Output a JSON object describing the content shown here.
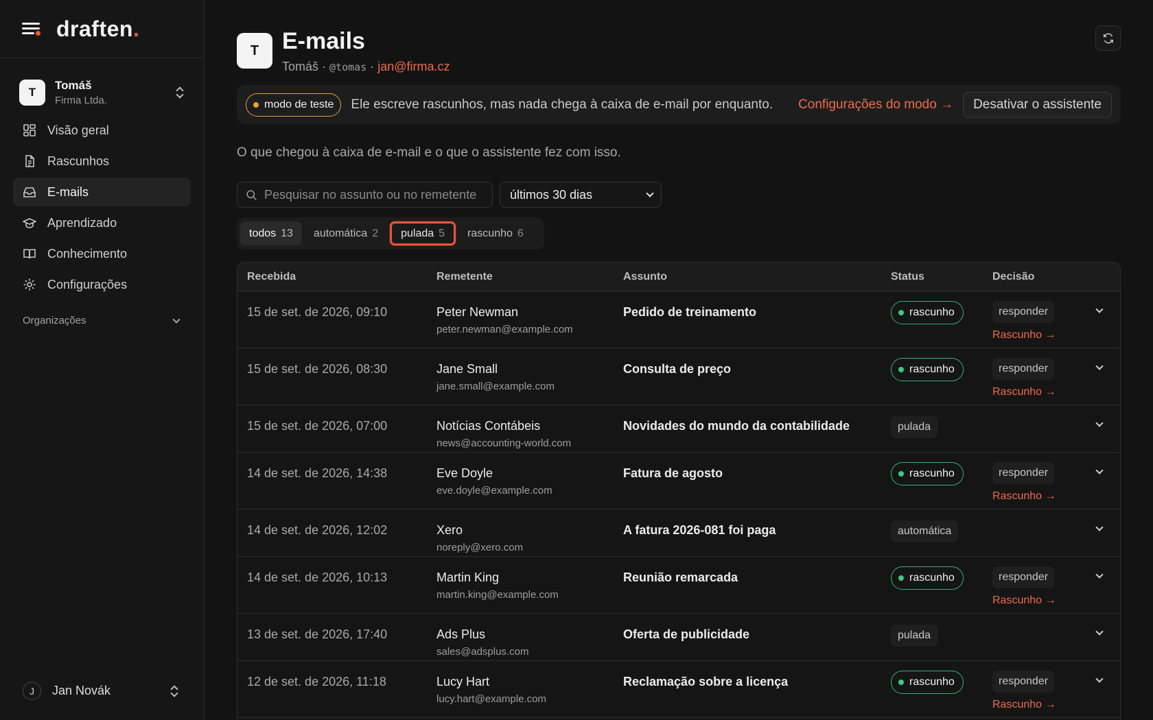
{
  "brand": {
    "name": "draften",
    "accent_char": "."
  },
  "workspace": {
    "initial": "T",
    "name": "Tomáš",
    "org": "Firma Ltda."
  },
  "nav": [
    {
      "label": "Visão geral",
      "icon": "grid-icon",
      "active": false
    },
    {
      "label": "Rascunhos",
      "icon": "document-icon",
      "active": false
    },
    {
      "label": "E-mails",
      "icon": "inbox-icon",
      "active": true
    },
    {
      "label": "Aprendizado",
      "icon": "graduation-cap-icon",
      "active": false
    },
    {
      "label": "Conhecimento",
      "icon": "book-icon",
      "active": false
    },
    {
      "label": "Configurações",
      "icon": "gear-icon",
      "active": false
    }
  ],
  "organizations_label": "Organizações",
  "user": {
    "initial": "J",
    "name": "Jan Novák"
  },
  "header": {
    "initial": "T",
    "title": "E-mails",
    "name": "Tomáš",
    "separator": "·",
    "handle": "@tomas",
    "email": "jan@firma.cz"
  },
  "banner": {
    "badge": "modo de teste",
    "text": "Ele escreve rascunhos, mas nada chega à caixa de e-mail por enquanto.",
    "link": "Configurações do modo →",
    "button": "Desativar o assistente"
  },
  "intro": "O que chegou à caixa de e-mail e o que o assistente fez com isso.",
  "search": {
    "placeholder": "Pesquisar no assunto ou no remetente",
    "value": ""
  },
  "period": {
    "selected": "últimos 30 dias"
  },
  "filters": [
    {
      "label": "todos",
      "count": "13"
    },
    {
      "label": "automática",
      "count": "2"
    },
    {
      "label": "pulada",
      "count": "5"
    },
    {
      "label": "rascunho",
      "count": "6"
    }
  ],
  "colors": {
    "accent": "#ef6a4c",
    "draft": "#38b27a",
    "test_mode": "#d9a441",
    "focus": "#e8553d"
  },
  "table": {
    "headers": [
      "Recebida",
      "Remetente",
      "Assunto",
      "Status",
      "Decisão"
    ],
    "rows": [
      {
        "date": "15 de set. de 2026, 09:10",
        "name": "Peter Newman",
        "email": "peter.newman@example.com",
        "subject": "Pedido de treinamento",
        "status": "rascunho",
        "decision": "responder",
        "link": "Rascunho →"
      },
      {
        "date": "15 de set. de 2026, 08:30",
        "name": "Jane Small",
        "email": "jane.small@example.com",
        "subject": "Consulta de preço",
        "status": "rascunho",
        "decision": "responder",
        "link": "Rascunho →"
      },
      {
        "date": "15 de set. de 2026, 07:00",
        "name": "Notícias Contábeis",
        "email": "news@accounting-world.com",
        "subject": "Novidades do mundo da contabilidade",
        "status": "pulada",
        "decision": "",
        "link": ""
      },
      {
        "date": "14 de set. de 2026, 14:38",
        "name": "Eve Doyle",
        "email": "eve.doyle@example.com",
        "subject": "Fatura de agosto",
        "status": "rascunho",
        "decision": "responder",
        "link": "Rascunho →"
      },
      {
        "date": "14 de set. de 2026, 12:02",
        "name": "Xero",
        "email": "noreply@xero.com",
        "subject": "A fatura 2026-081 foi paga",
        "status": "automática",
        "decision": "",
        "link": ""
      },
      {
        "date": "14 de set. de 2026, 10:13",
        "name": "Martin King",
        "email": "martin.king@example.com",
        "subject": "Reunião remarcada",
        "status": "rascunho",
        "decision": "responder",
        "link": "Rascunho →"
      },
      {
        "date": "13 de set. de 2026, 17:40",
        "name": "Ads Plus",
        "email": "sales@adsplus.com",
        "subject": "Oferta de publicidade",
        "status": "pulada",
        "decision": "",
        "link": ""
      },
      {
        "date": "12 de set. de 2026, 11:18",
        "name": "Lucy Hart",
        "email": "lucy.hart@example.com",
        "subject": "Reclamação sobre a licença",
        "status": "rascunho",
        "decision": "responder",
        "link": "Rascunho →"
      }
    ]
  }
}
